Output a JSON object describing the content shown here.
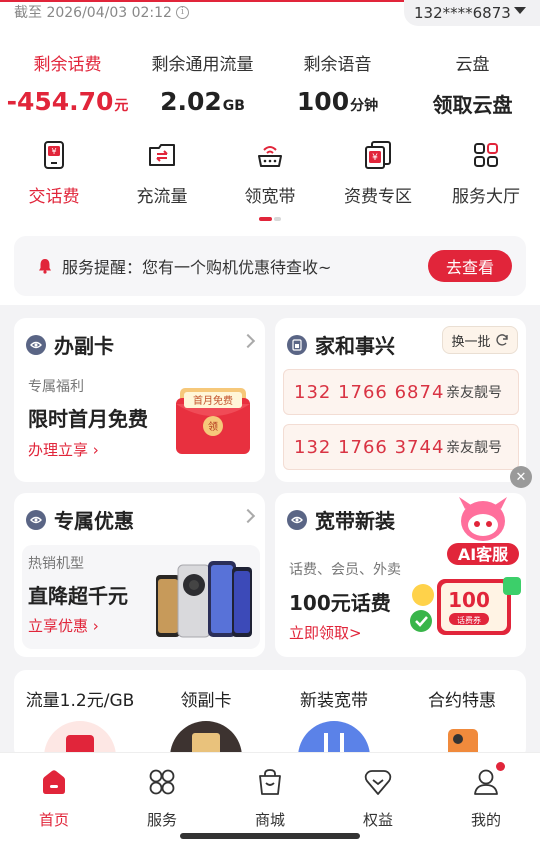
{
  "header": {
    "deadline": "截至 2026/04/03 02:12",
    "phone": "132****6873"
  },
  "stats": [
    {
      "label": "剩余话费",
      "value": "-454.70",
      "unit": "元"
    },
    {
      "label": "剩余通用流量",
      "value": "2.02",
      "unit": "GB"
    },
    {
      "label": "剩余语音",
      "value": "100",
      "unit": "分钟"
    },
    {
      "label": "云盘",
      "value": "领取云盘",
      "unit": ""
    }
  ],
  "quick": [
    {
      "label": "交话费",
      "icon": "phone-bill-icon"
    },
    {
      "label": "充流量",
      "icon": "data-recharge-icon"
    },
    {
      "label": "领宽带",
      "icon": "router-icon"
    },
    {
      "label": "资费专区",
      "icon": "tariff-icon"
    },
    {
      "label": "服务大厅",
      "icon": "grid-icon"
    }
  ],
  "notice": {
    "text": "服务提醒：您有一个购机优惠待查收~",
    "button": "去查看"
  },
  "card_secondary": {
    "title": "办副卡",
    "sub": "专属福利",
    "big": "限时首月免费",
    "link": "办理立享",
    "envelope_text": "首月免费",
    "envelope_badge": "领"
  },
  "card_family": {
    "title": "家和事兴",
    "swap": "换一批",
    "numbers": [
      {
        "number": "132  1766  6874",
        "tag": "亲友靓号"
      },
      {
        "number": "132  1766  3744",
        "tag": "亲友靓号"
      }
    ]
  },
  "card_exclusive": {
    "title": "专属优惠",
    "sub": "热销机型",
    "big": "直降超千元",
    "link": "立享优惠"
  },
  "card_broadband": {
    "title": "宽带新装",
    "sub": "话费、会员、外卖",
    "big": "100元话费",
    "link": "立即领取>",
    "ai_label": "AI客服",
    "coupon_value": "100",
    "coupon_label": "话费券"
  },
  "promos": [
    {
      "label": "流量1.2元/GB"
    },
    {
      "label": "领副卡"
    },
    {
      "label": "新装宽带"
    },
    {
      "label": "合约特惠"
    }
  ],
  "tabs": [
    {
      "label": "首页",
      "icon": "home-icon",
      "active": true
    },
    {
      "label": "服务",
      "icon": "services-icon",
      "active": false
    },
    {
      "label": "商城",
      "icon": "shop-bag-icon",
      "active": false
    },
    {
      "label": "权益",
      "icon": "heart-benefits-icon",
      "active": false
    },
    {
      "label": "我的",
      "icon": "profile-icon",
      "active": false
    }
  ],
  "colors": {
    "accent": "#e1253a",
    "background": "#f3f3f5",
    "card": "#ffffff"
  }
}
